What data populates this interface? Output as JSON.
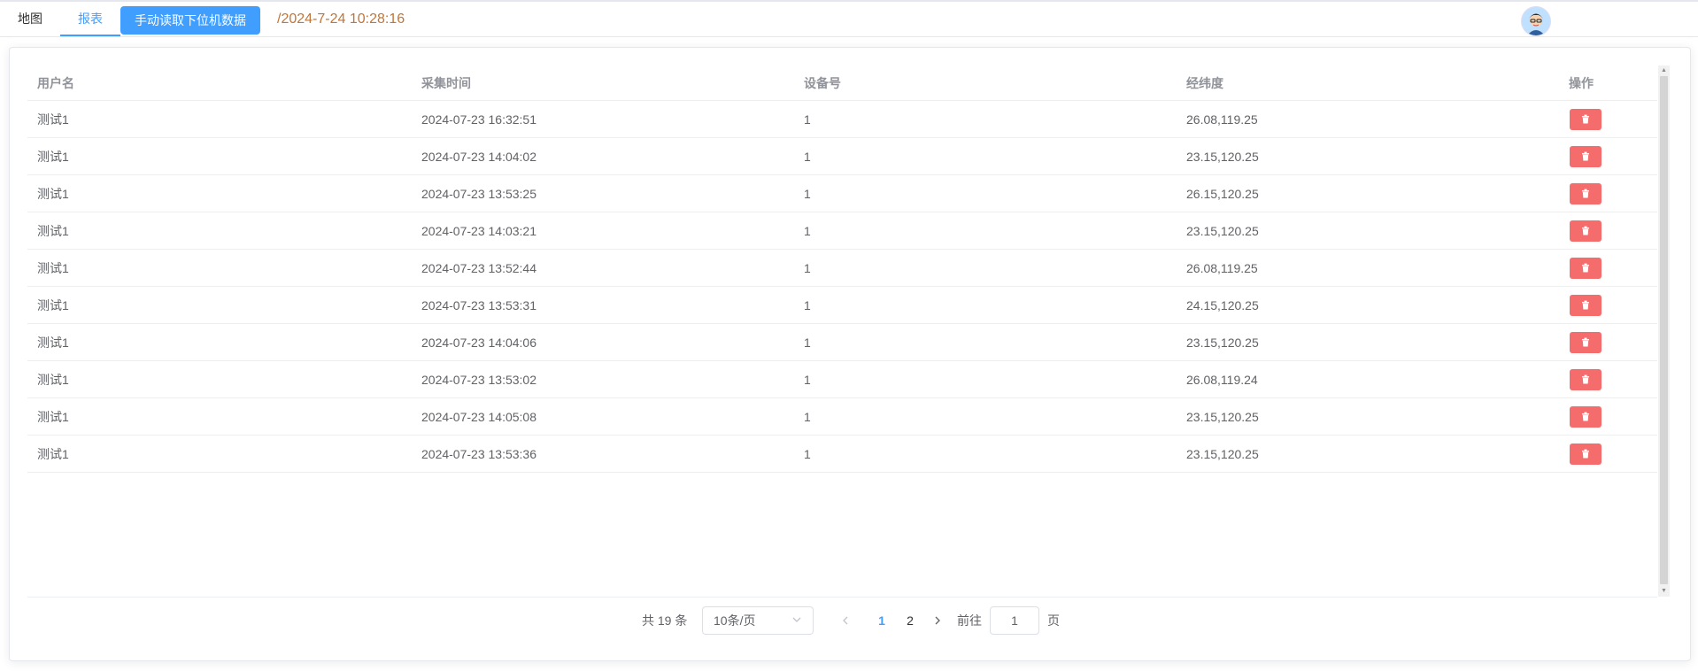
{
  "header": {
    "tabs": [
      {
        "label": "地图"
      },
      {
        "label": "报表"
      }
    ],
    "read_button_label": "手动读取下位机数据",
    "datetime": "/2024-7-24 10:28:16"
  },
  "table": {
    "columns": [
      "用户名",
      "采集时间",
      "设备号",
      "经纬度",
      "操作"
    ],
    "rows": [
      {
        "user": "测试1",
        "time": "2024-07-23 16:32:51",
        "device": "1",
        "coords": "26.08,119.25"
      },
      {
        "user": "测试1",
        "time": "2024-07-23 14:04:02",
        "device": "1",
        "coords": "23.15,120.25"
      },
      {
        "user": "测试1",
        "time": "2024-07-23 13:53:25",
        "device": "1",
        "coords": "26.15,120.25"
      },
      {
        "user": "测试1",
        "time": "2024-07-23 14:03:21",
        "device": "1",
        "coords": "23.15,120.25"
      },
      {
        "user": "测试1",
        "time": "2024-07-23 13:52:44",
        "device": "1",
        "coords": "26.08,119.25"
      },
      {
        "user": "测试1",
        "time": "2024-07-23 13:53:31",
        "device": "1",
        "coords": "24.15,120.25"
      },
      {
        "user": "测试1",
        "time": "2024-07-23 14:04:06",
        "device": "1",
        "coords": "23.15,120.25"
      },
      {
        "user": "测试1",
        "time": "2024-07-23 13:53:02",
        "device": "1",
        "coords": "26.08,119.24"
      },
      {
        "user": "测试1",
        "time": "2024-07-23 14:05:08",
        "device": "1",
        "coords": "23.15,120.25"
      },
      {
        "user": "测试1",
        "time": "2024-07-23 13:53:36",
        "device": "1",
        "coords": "23.15,120.25"
      }
    ],
    "delete_icon": "trash-icon"
  },
  "pagination": {
    "total_text": "共 19 条",
    "page_size": "10条/页",
    "pages": [
      "1",
      "2"
    ],
    "current_page": "1",
    "goto_label": "前往",
    "goto_value": "1",
    "page_suffix": "页"
  },
  "colors": {
    "primary": "#409eff",
    "danger": "#f56c6c",
    "datetime": "#c0763a"
  }
}
